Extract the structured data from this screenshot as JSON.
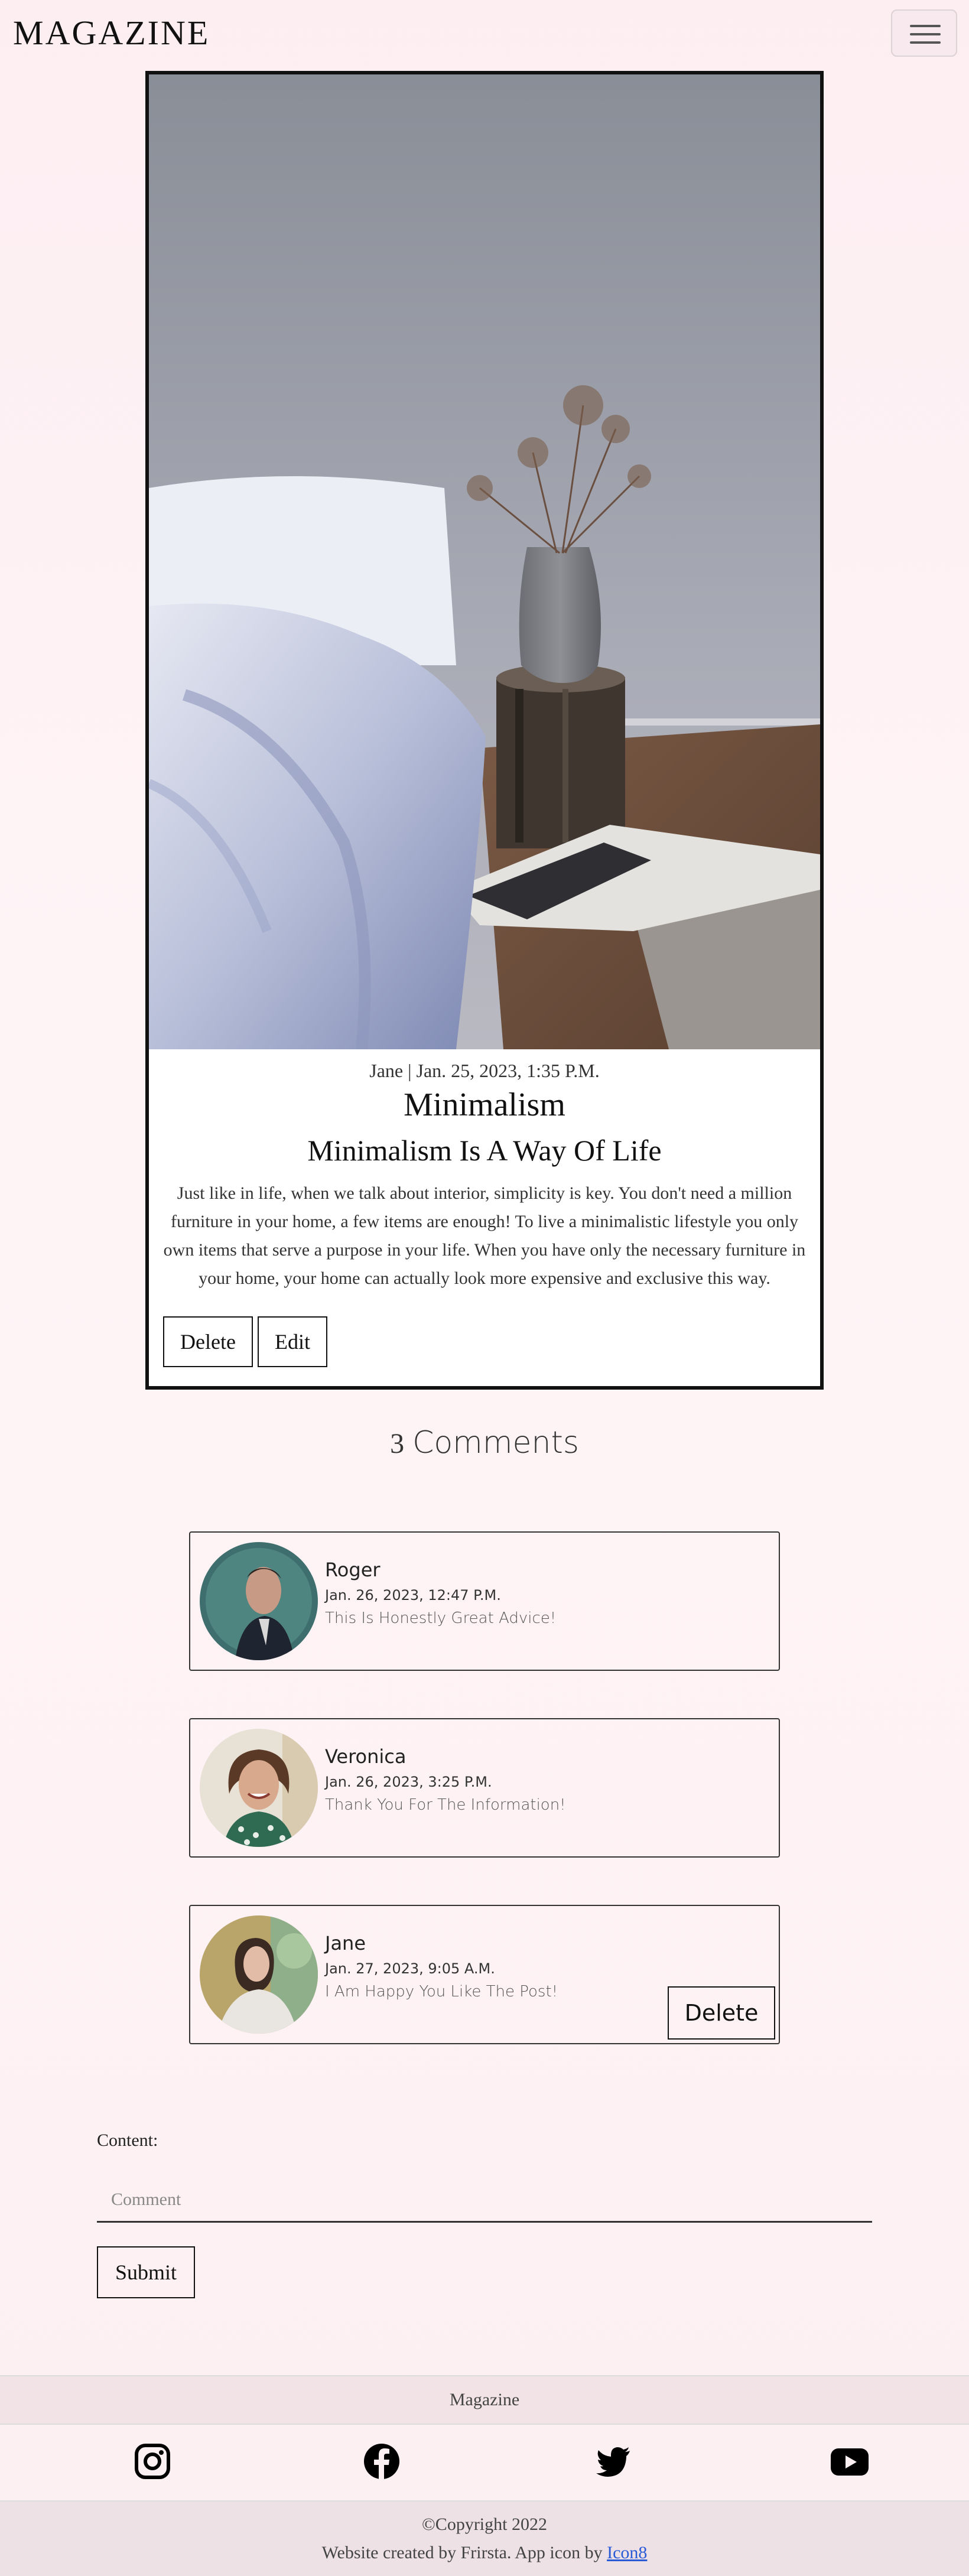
{
  "navbar": {
    "brand": "MAGAZINE"
  },
  "post": {
    "meta": "Jane | Jan. 25, 2023, 1:35 P.M.",
    "title": "Minimalism",
    "subtitle": "Minimalism Is A Way Of Life",
    "body": "Just like in life, when we talk about interior, simplicity is key. You don't need a million furniture in your home, a few items are enough! To live a minimalistic lifestyle you only own items that serve a purpose in your life. When you have only the necessary furniture in your home, your home can actually look more expensive and exclusive this way.",
    "delete_label": "Delete",
    "edit_label": "Edit"
  },
  "comments_section": {
    "count": "3",
    "heading": "Comments",
    "items": [
      {
        "name": "Roger",
        "date": "Jan. 26, 2023, 12:47 P.M.",
        "text": "This Is Honestly Great Advice!"
      },
      {
        "name": "Veronica",
        "date": "Jan. 26, 2023, 3:25 P.M.",
        "text": "Thank You For The Information!"
      },
      {
        "name": "Jane",
        "date": "Jan. 27, 2023, 9:05 A.M.",
        "text": "I Am Happy You Like The Post!",
        "delete_label": "Delete"
      }
    ]
  },
  "form": {
    "content_label": "Content:",
    "placeholder": "Comment",
    "submit_label": "Submit"
  },
  "footer": {
    "title": "Magazine",
    "social_icons": [
      "instagram-icon",
      "facebook-icon",
      "twitter-icon",
      "youtube-icon"
    ],
    "copyright": "©Copyright 2022",
    "credits_prefix": "Website created by Frirsta. App icon by ",
    "credits_link": "Icon8"
  }
}
